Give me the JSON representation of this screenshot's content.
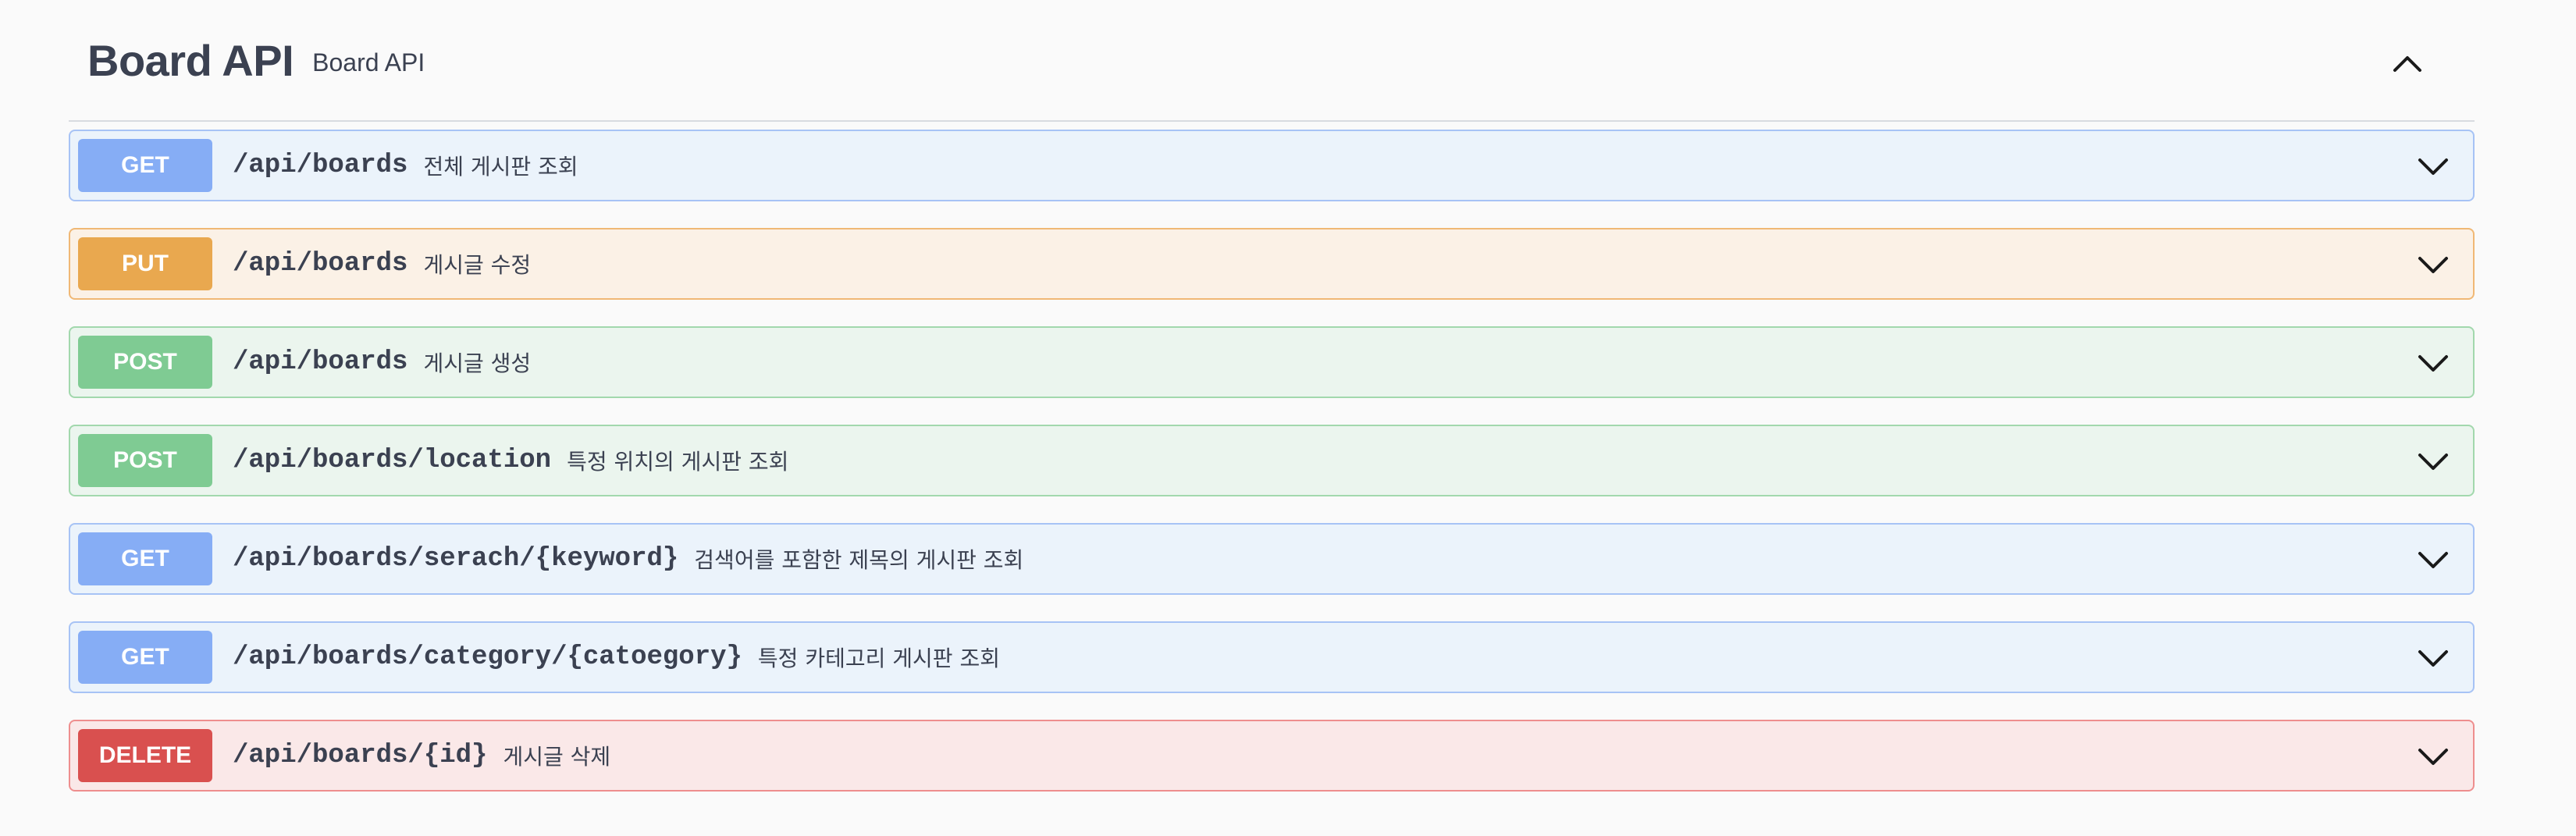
{
  "tag": {
    "name": "Board API",
    "description": "Board API"
  },
  "operations": [
    {
      "method": "GET",
      "path": "/api/boards",
      "summary": "전체 게시판 조회",
      "color": "#86adf5"
    },
    {
      "method": "PUT",
      "path": "/api/boards",
      "summary": "게시글 수정",
      "color": "#e9a84f"
    },
    {
      "method": "POST",
      "path": "/api/boards",
      "summary": "게시글 생성",
      "color": "#7fcb93"
    },
    {
      "method": "POST",
      "path": "/api/boards/location",
      "summary": "특정 위치의 게시판 조회",
      "color": "#7fcb93"
    },
    {
      "method": "GET",
      "path": "/api/boards/serach/{keyword}",
      "summary": "검색어를 포함한 제목의 게시판 조회",
      "color": "#86adf5"
    },
    {
      "method": "GET",
      "path": "/api/boards/category/{catoegory}",
      "summary": "특정 카테고리 게시판 조회",
      "color": "#86adf5"
    },
    {
      "method": "DELETE",
      "path": "/api/boards/{id}",
      "summary": "게시글 삭제",
      "color": "#d9504f"
    }
  ],
  "icons": {
    "collapse": "chevron-up-icon",
    "expand": "chevron-down-icon"
  }
}
